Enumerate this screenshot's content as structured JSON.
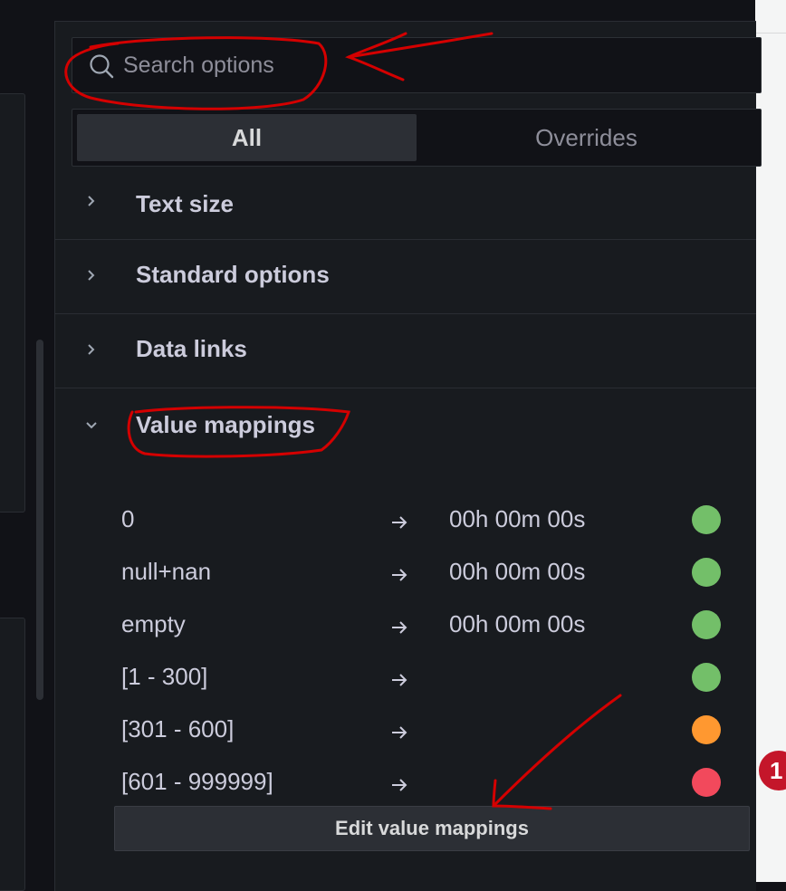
{
  "search": {
    "placeholder": "Search options"
  },
  "tabs": [
    {
      "label": "All",
      "active": true
    },
    {
      "label": "Overrides",
      "active": false
    }
  ],
  "sections": {
    "text_size": "Text size",
    "standard_options": "Standard options",
    "data_links": "Data links",
    "value_mappings": "Value mappings"
  },
  "mappings": [
    {
      "from": "0",
      "to": "00h 00m 00s",
      "color": "#73bf69"
    },
    {
      "from": "null+nan",
      "to": "00h 00m 00s",
      "color": "#73bf69"
    },
    {
      "from": "empty",
      "to": "00h 00m 00s",
      "color": "#73bf69"
    },
    {
      "from": "[1 - 300]",
      "to": "",
      "color": "#73bf69"
    },
    {
      "from": "[301 - 600]",
      "to": "",
      "color": "#ff9830"
    },
    {
      "from": "[601 - 999999]",
      "to": "",
      "color": "#f2495c"
    }
  ],
  "edit_button_label": "Edit value mappings",
  "notification_badge": "1",
  "colors": {
    "annotation": "#d40000",
    "ok_green": "#73bf69",
    "warn_orange": "#ff9830",
    "crit_red": "#f2495c"
  }
}
